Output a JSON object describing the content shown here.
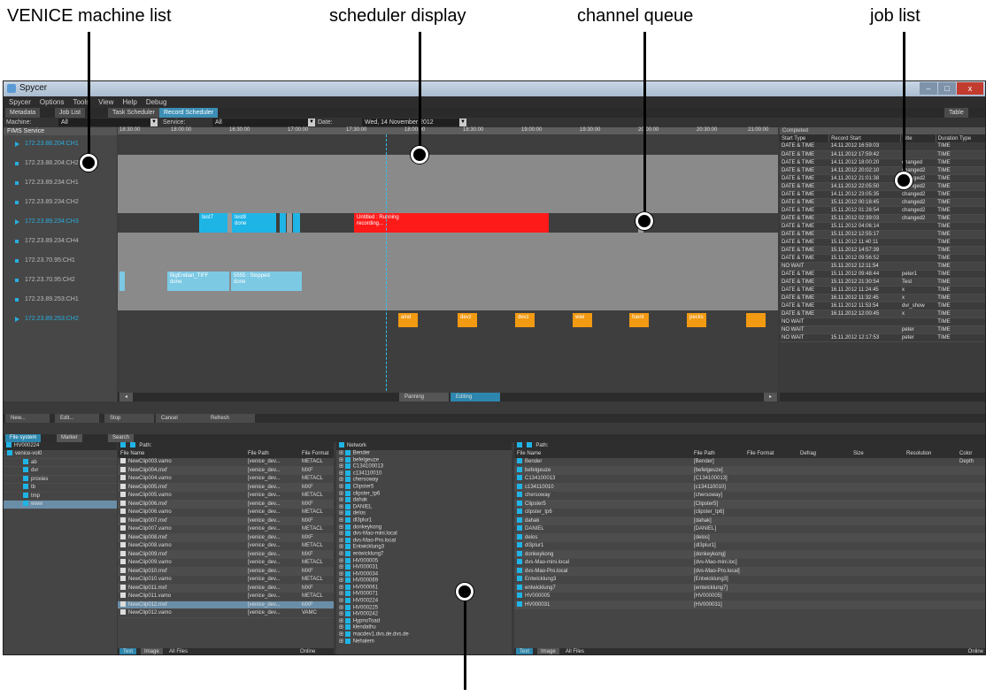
{
  "annotations": {
    "machine_list": "VENICE machine list",
    "scheduler": "scheduler display",
    "channel_queue": "channel queue",
    "job_list": "job list"
  },
  "window": {
    "title": "Spycer",
    "controls": [
      "–",
      "□",
      "x"
    ]
  },
  "menu": [
    "Spycer",
    "Options",
    "Tools",
    "View",
    "Help",
    "Debug"
  ],
  "tabs": [
    "Metadata",
    "Job List",
    "Task Scheduler",
    "Record Scheduler",
    "Table"
  ],
  "filters": {
    "machine_label": "Machine:",
    "machine_value": "All",
    "service_label": "Service:",
    "service_value": "All",
    "date_label": "Date:",
    "date_value": "Wed, 14 November 2012"
  },
  "machines": {
    "header": "FIMS Service",
    "items": [
      {
        "name": "172.23.88.204:CH1",
        "active": true
      },
      {
        "name": "172.23.88.204:CH2",
        "active": false
      },
      {
        "name": "172.23.89.234:CH1",
        "active": false
      },
      {
        "name": "172.23.89.234:CH2",
        "active": false
      },
      {
        "name": "172.23.89.234:CH3",
        "active": true
      },
      {
        "name": "172.23.89.234:CH4",
        "active": false
      },
      {
        "name": "172.23.70.95:CH1",
        "active": false
      },
      {
        "name": "172.23.70.95:CH2",
        "active": false
      },
      {
        "name": "172.23.89.253:CH1",
        "active": false
      },
      {
        "name": "172.23.89.253:CH2",
        "active": true
      }
    ]
  },
  "scheduler": {
    "times": [
      "18:30:00",
      "18:00:00",
      "16:30:00",
      "17:00:00",
      "17:30:00",
      "18:00:00",
      "18:30:00",
      "19:00:00",
      "19:30:00",
      "20:00:00",
      "20:30:00",
      "21:00:00"
    ],
    "blocks": {
      "test7": "test7",
      "test8": "test8",
      "test8_status": "done",
      "untitled": "Untitled : Running",
      "untitled_status": "recording...",
      "bigendian": "BigEndian_TIFF",
      "bigendian_status": "done",
      "s5555": "5555 : Stopped",
      "s5555_status": "done",
      "orange": [
        "aind",
        "devz",
        "devz",
        "wiei",
        "fuent",
        "pecks"
      ]
    },
    "buttons": {
      "panning": "Panning",
      "editing": "Editing"
    }
  },
  "jobs": {
    "title": "Completed",
    "columns": [
      "Start Type",
      "Record Start",
      "Title",
      "Duration Type"
    ],
    "rows": [
      [
        "DATE & TIME",
        "14.11.2012 16:59:03",
        "",
        "TIME"
      ],
      [
        "DATE & TIME",
        "14.11.2012 17:59:42",
        "",
        "TIME"
      ],
      [
        "DATE & TIME",
        "14.11.2012 18:00:20",
        "changed",
        "TIME"
      ],
      [
        "DATE & TIME",
        "14.11.2012 20:02:10",
        "changed2",
        "TIME"
      ],
      [
        "DATE & TIME",
        "14.11.2012 21:01:38",
        "changed2",
        "TIME"
      ],
      [
        "DATE & TIME",
        "14.11.2012 22:05:50",
        "changed2",
        "TIME"
      ],
      [
        "DATE & TIME",
        "14.11.2012 23:05:35",
        "changed2",
        "TIME"
      ],
      [
        "DATE & TIME",
        "15.11.2012 00:18:45",
        "changed2",
        "TIME"
      ],
      [
        "DATE & TIME",
        "15.11.2012 01:28:54",
        "changed2",
        "TIME"
      ],
      [
        "DATE & TIME",
        "15.11.2012 02:39:03",
        "changed2",
        "TIME"
      ],
      [
        "DATE & TIME",
        "15.11.2012 04:06:14",
        "",
        "TIME"
      ],
      [
        "DATE & TIME",
        "15.11.2012 12:55:17",
        "",
        "TIME"
      ],
      [
        "DATE & TIME",
        "15.11.2012 11:40:11",
        "",
        "TIME"
      ],
      [
        "DATE & TIME",
        "15.11.2012 14:57:39",
        "",
        "TIME"
      ],
      [
        "DATE & TIME",
        "15.11.2012 09:56:52",
        "",
        "TIME"
      ],
      [
        "NO WAIT",
        "15.11.2012 12:11:54",
        "",
        "TIME"
      ],
      [
        "DATE & TIME",
        "15.11.2012 09:48:44",
        "peter1",
        "TIME"
      ],
      [
        "DATE & TIME",
        "15.11.2012 21:30:54",
        "Test",
        "TIME"
      ],
      [
        "DATE & TIME",
        "16.11.2012 11:24:45",
        "x",
        "TIME"
      ],
      [
        "DATE & TIME",
        "16.11.2012 11:32:45",
        "x",
        "TIME"
      ],
      [
        "DATE & TIME",
        "16.11.2012 11:53:54",
        "dvr_show",
        "TIME"
      ],
      [
        "DATE & TIME",
        "16.11.2012 12:00:45",
        "x",
        "TIME"
      ],
      [
        "NO WAIT",
        "",
        "",
        "TIME"
      ],
      [
        "NO WAIT",
        "",
        "peter",
        "TIME"
      ],
      [
        "NO WAIT",
        "15.11.2012 12:17:53",
        "peter",
        "TIME"
      ]
    ]
  },
  "toolbar": [
    "New...",
    "Edit...",
    "Stop",
    "Cancel",
    "Refresh"
  ],
  "bottom_tabs": [
    "File system",
    "Marker",
    "Search"
  ],
  "left_tree": {
    "drive": "HV000224",
    "items": [
      "venice-vol0",
      "ab",
      "dvr",
      "proxies",
      "tb",
      "tmp",
      "www"
    ]
  },
  "file_list": {
    "path_label": "Path:",
    "columns": [
      "File Name",
      "File Path",
      "File Format"
    ],
    "rows": [
      [
        "NewClip003.vamo",
        "[venice_dev...",
        "METACL"
      ],
      [
        "NewClip004.mxf",
        "[venice_dev...",
        "MXF"
      ],
      [
        "NewClip004.vamo",
        "[venice_dev...",
        "METACL"
      ],
      [
        "NewClip005.mxf",
        "[venice_dev...",
        "MXF"
      ],
      [
        "NewClip005.vamo",
        "[venice_dev...",
        "METACL"
      ],
      [
        "NewClip006.mxf",
        "[venice_dev...",
        "MXF"
      ],
      [
        "NewClip006.vamo",
        "[venice_dev...",
        "METACL"
      ],
      [
        "NewClip007.mxf",
        "[venice_dev...",
        "MXF"
      ],
      [
        "NewClip007.vamo",
        "[venice_dev...",
        "METACL"
      ],
      [
        "NewClip008.mxf",
        "[venice_dev...",
        "MXF"
      ],
      [
        "NewClip008.vamo",
        "[venice_dev...",
        "METACL"
      ],
      [
        "NewClip009.mxf",
        "[venice_dev...",
        "MXF"
      ],
      [
        "NewClip009.vamo",
        "[venice_dev...",
        "METACL"
      ],
      [
        "NewClip010.mxf",
        "[venice_dev...",
        "MXF"
      ],
      [
        "NewClip010.vamo",
        "[venice_dev...",
        "METACL"
      ],
      [
        "NewClip011.mxf",
        "[venice_dev...",
        "MXF"
      ],
      [
        "NewClip011.vamo",
        "[venice_dev...",
        "METACL"
      ],
      [
        "NewClip012.mxf",
        "[venice_dev...",
        "MXF"
      ],
      [
        "NewClip012.vamo",
        "[venice_dev...",
        "VAMC"
      ]
    ],
    "foot": {
      "text": "Text",
      "image": "Image",
      "filter": "All Files",
      "online": "Online"
    }
  },
  "network": {
    "title": "Network",
    "items": [
      "Bender",
      "befelgeuze",
      "C134100013",
      "c134110010",
      "chersoway",
      "Clipster5",
      "clipster_tp6",
      "dahak",
      "DANIEL",
      "delos",
      "dl3plur1",
      "donkeykong",
      "dvs-Mao-mini.local",
      "dvs-Mao-Pro.local",
      "Entwicklung3",
      "entwicklung7",
      "HV000005",
      "HV000031",
      "HV000034",
      "HV000069",
      "HV000061",
      "HV000071",
      "HV000224",
      "HV000225",
      "HV000242",
      "HypnoToad",
      "klendathu",
      "macdev1.dvs.de.dvs.de",
      "Nehalem"
    ]
  },
  "right_list": {
    "path_label": "Path:",
    "columns": [
      "File Name",
      "File Path",
      "File Format",
      "Defrag",
      "Size",
      "Resolution",
      "Color Depth"
    ],
    "rows": [
      [
        "Bender",
        "[Bender]"
      ],
      [
        "befelgeuze",
        "[befelgeuze]"
      ],
      [
        "C134100013",
        "[C134100013]"
      ],
      [
        "c134110010",
        "[c134110010]"
      ],
      [
        "chersoway",
        "[chersoway]"
      ],
      [
        "Clipster5",
        "[Clipster5]"
      ],
      [
        "clipster_tp6",
        "[clipster_tp6]"
      ],
      [
        "dahak",
        "[dahak]"
      ],
      [
        "DANIEL",
        "[DANIEL]"
      ],
      [
        "delos",
        "[delos]"
      ],
      [
        "dl3plur1",
        "[dl3plur1]"
      ],
      [
        "donkeykong",
        "[donkeykong]"
      ],
      [
        "dvs-Mao-mini.local",
        "[dvs-Mao-mini.loc]"
      ],
      [
        "dvs-Mao-Pro.local",
        "[dvs-Mao-Pro.local]"
      ],
      [
        "Entwicklung3",
        "[Entwicklung3]"
      ],
      [
        "entwicklung7",
        "[entwicklung7]"
      ],
      [
        "HV000005",
        "[HV000005]"
      ],
      [
        "HV000031",
        "[HV000031]"
      ]
    ],
    "foot": {
      "text": "Text",
      "image": "Image",
      "filter": "All Files",
      "online": "Online"
    }
  }
}
